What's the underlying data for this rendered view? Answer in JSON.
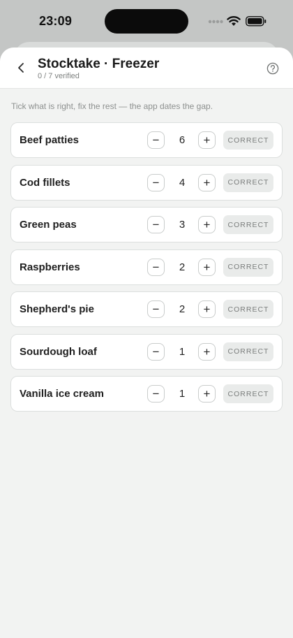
{
  "status_bar": {
    "time": "23:09"
  },
  "header": {
    "title": "Stocktake · Freezer",
    "subtitle": "0 / 7 verified"
  },
  "hint": "Tick what is right, fix the rest — the app dates the gap.",
  "correct_label": "CORRECT",
  "stepper": {
    "minus": "−",
    "plus": "+"
  },
  "items": [
    {
      "name": "Beef patties",
      "qty": "6"
    },
    {
      "name": "Cod fillets",
      "qty": "4"
    },
    {
      "name": "Green peas",
      "qty": "3"
    },
    {
      "name": "Raspberries",
      "qty": "2"
    },
    {
      "name": "Shepherd's pie",
      "qty": "2"
    },
    {
      "name": "Sourdough loaf",
      "qty": "1"
    },
    {
      "name": "Vanilla ice cream",
      "qty": "1"
    }
  ],
  "icons": {
    "back": "chevron-left-icon",
    "help": "question-circle-icon",
    "signal": "cellular-signal-icon",
    "wifi": "wifi-icon",
    "battery": "battery-icon"
  }
}
